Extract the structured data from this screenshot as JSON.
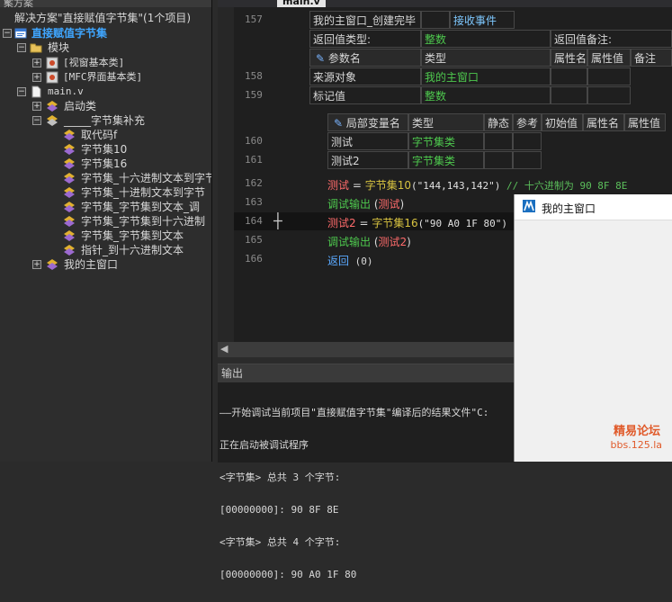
{
  "solution": {
    "title": "案方案",
    "root": "解决方案\"直接赋值字节集\"(1个项目)",
    "project": "直接赋值字节集",
    "modules": "模块",
    "module_items": [
      "[视窗基本类]",
      "[MFC界面基本类]"
    ],
    "file": "main.v",
    "startup_class": "启动类",
    "bytes_class": "_____字节集补充",
    "methods": [
      "取代码f",
      "字节集10",
      "字节集16",
      "字节集_十六进制文本到字节",
      "字节集_十进制文本到字节",
      "字节集_字节集到文本_调",
      "字节集_字节集到十六进制",
      "字节集_字节集到文本",
      "指针_到十六进制文本"
    ],
    "main_window": "我的主窗口"
  },
  "editor": {
    "tab": "main.v",
    "event_row": {
      "line": "157",
      "name": "我的主窗口_创建完毕",
      "type": "接收事件"
    },
    "return_type_label": "返回值类型:",
    "return_type": "整数",
    "return_note_label": "返回值备注:",
    "param_headers": [
      "参数名",
      "类型",
      "属性名",
      "属性值",
      "备注"
    ],
    "params": [
      {
        "line": "158",
        "name": "来源对象",
        "type": "我的主窗口"
      },
      {
        "line": "159",
        "name": "标记值",
        "type": "整数"
      }
    ],
    "local_headers": [
      "局部变量名",
      "类型",
      "静态",
      "参考",
      "初始值",
      "属性名",
      "属性值"
    ],
    "locals": [
      {
        "line": "160",
        "name": "测试",
        "type": "字节集类"
      },
      {
        "line": "161",
        "name": "测试2",
        "type": "字节集类"
      }
    ],
    "code": [
      {
        "line": "162",
        "var": "测试",
        "op": " = ",
        "fn": "字节集10",
        "arg": "(\"144,143,142\")",
        "comment": "  // 十六进制为 90 8F 8E"
      },
      {
        "line": "163",
        "fn": "调试输出",
        "open": " (",
        "var": "测试",
        "close": ")"
      },
      {
        "line": "164",
        "var": "测试2",
        "op": " = ",
        "fn": "字节集16",
        "arg": "(\"90 A0 1F 80\")"
      },
      {
        "line": "165",
        "fn": "调试输出",
        "open": " (",
        "var": "测试2",
        "close": ")"
      },
      {
        "line": "166",
        "kw": "返回",
        "arg": " (0)"
      }
    ]
  },
  "output": {
    "header": "输出",
    "lines": [
      "——开始调试当前项目\"直接赋值字节集\"编译后的结果文件\"C:",
      "正在启动被调试程序",
      "<字节集> 总共 3 个字节:",
      "[00000000]: 90 8F 8E",
      "<字节集> 总共 4 个字节:",
      "[00000000]: 90 A0 1F 80"
    ]
  },
  "popup": {
    "title": "我的主窗口",
    "watermark_name": "精易论坛",
    "watermark_url": "bbs.125.la"
  },
  "colors": {
    "accent_blue": "#3fa6ff",
    "type_green": "#4ec94e",
    "var_red": "#ff6b6b",
    "func_yellow": "#d7c240",
    "watermark": "#e05a2a"
  }
}
